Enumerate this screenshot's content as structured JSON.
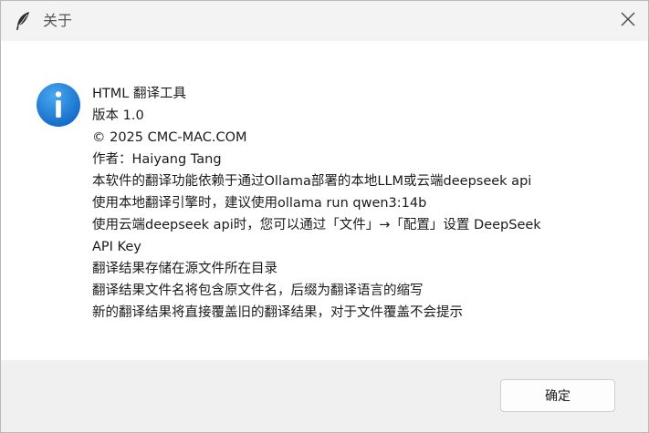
{
  "window": {
    "title": "关于",
    "app_icon": "feather-icon",
    "close_icon": "close-icon"
  },
  "dialog": {
    "icon": "info-icon",
    "lines": [
      "HTML 翻译工具",
      "版本 1.0",
      "© 2025 CMC-MAC.COM",
      "作者：Haiyang Tang",
      "本软件的翻译功能依赖于通过Ollama部署的本地LLM或云端deepseek api",
      "使用本地翻译引擎时，建议使用ollama run qwen3:14b",
      "使用云端deepseek api时，您可以通过「文件」→「配置」设置 DeepSeek",
      "API Key",
      "翻译结果存储在源文件所在目录",
      "翻译结果文件名将包含原文件名，后缀为翻译语言的缩写",
      "新的翻译结果将直接覆盖旧的翻译结果，对于文件覆盖不会提示"
    ]
  },
  "footer": {
    "ok_label": "确定"
  },
  "colors": {
    "info_icon": "#1a7fd8",
    "content_bg": "#ffffff",
    "chrome_bg": "#f3f3f3"
  }
}
